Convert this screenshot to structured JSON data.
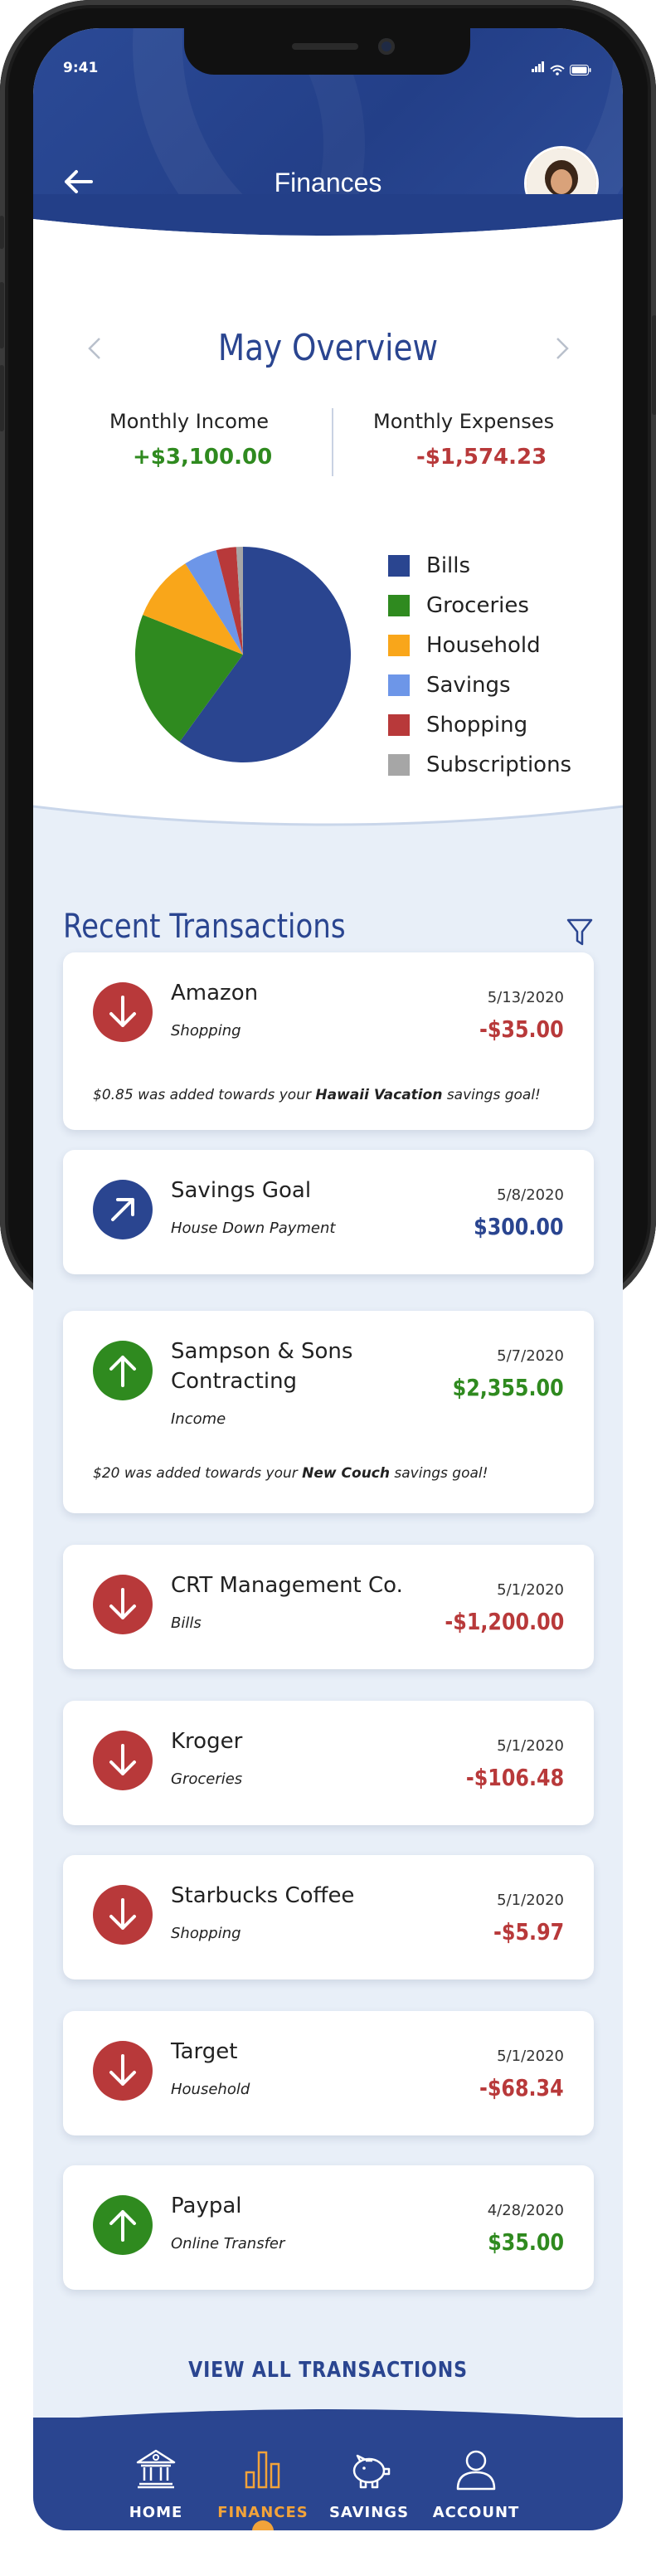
{
  "status": {
    "time": "9:41"
  },
  "header": {
    "title": "Finances"
  },
  "overview": {
    "month": "May Overview",
    "income_label": "Monthly Income",
    "income_value": "+$3,100.00",
    "expenses_label": "Monthly Expenses",
    "expenses_value": "-$1,574.23"
  },
  "chart_data": {
    "type": "pie",
    "title": "",
    "categories": [
      "Bills",
      "Groceries",
      "Household",
      "Savings",
      "Shopping",
      "Subscriptions"
    ],
    "values": [
      60,
      21,
      10,
      5,
      3,
      1
    ],
    "colors": [
      "#2a4590",
      "#2f8a1f",
      "#f9a61a",
      "#6d96e8",
      "#b8393a",
      "#a6a6a6"
    ]
  },
  "transactions_title": "Recent Transactions",
  "transactions": [
    {
      "name": "Amazon",
      "category": "Shopping",
      "date": "5/13/2020",
      "amount": "-$35.00",
      "direction": "down",
      "note_pre": "$0.85 was added towards your ",
      "note_bold": "Hawaii Vacation",
      "note_post": " savings goal!"
    },
    {
      "name": "Savings Goal",
      "category": "House Down Payment",
      "date": "5/8/2020",
      "amount": "$300.00",
      "direction": "savings"
    },
    {
      "name": "Sampson & Sons",
      "name2": "Contracting",
      "category": "Income",
      "date": "5/7/2020",
      "amount": "$2,355.00",
      "direction": "up",
      "note_pre": "$20 was added towards your ",
      "note_bold": "New Couch",
      "note_post": " savings goal!"
    },
    {
      "name": "CRT Management Co.",
      "category": "Bills",
      "date": "5/1/2020",
      "amount": "-$1,200.00",
      "direction": "down"
    },
    {
      "name": "Kroger",
      "category": "Groceries",
      "date": "5/1/2020",
      "amount": "-$106.48",
      "direction": "down"
    },
    {
      "name": "Starbucks Coffee",
      "category": "Shopping",
      "date": "5/1/2020",
      "amount": "-$5.97",
      "direction": "down"
    },
    {
      "name": "Target",
      "category": "Household",
      "date": "5/1/2020",
      "amount": "-$68.34",
      "direction": "down"
    },
    {
      "name": "Paypal",
      "category": "Online Transfer",
      "date": "4/28/2020",
      "amount": "$35.00",
      "direction": "up"
    }
  ],
  "view_all_label": "VIEW ALL TRANSACTIONS",
  "nav": [
    {
      "label": "HOME",
      "icon": "bank-icon",
      "active": false
    },
    {
      "label": "FINANCES",
      "icon": "bar-chart-icon",
      "active": true
    },
    {
      "label": "SAVINGS",
      "icon": "piggy-bank-icon",
      "active": false
    },
    {
      "label": "ACCOUNT",
      "icon": "user-icon",
      "active": false
    }
  ]
}
